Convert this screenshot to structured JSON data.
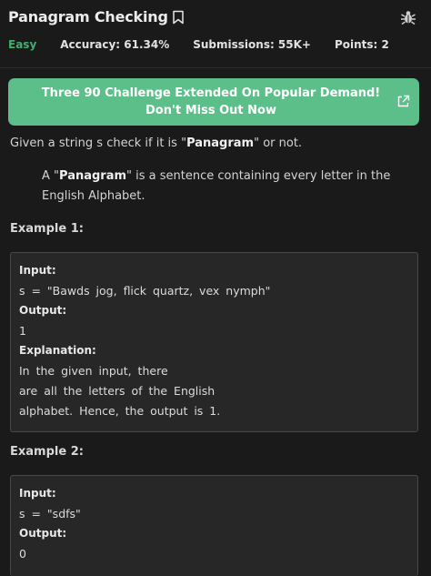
{
  "header": {
    "title": "Panagram Checking",
    "difficulty": "Easy",
    "accuracy": "Accuracy: 61.34%",
    "submissions": "Submissions: 55K+",
    "points": "Points: 2"
  },
  "banner": {
    "text": "Three 90 Challenge Extended On Popular Demand! Don't Miss Out Now"
  },
  "problem": {
    "intro_before": "Given a string s check if it is \"",
    "intro_bold": "Panagram",
    "intro_after": "\" or not.",
    "def_quote_open": "A \"",
    "def_bold": "Panagram",
    "def_line1_rest": "\" is a sentence containing every letter in the",
    "def_line2": "English Alphabet."
  },
  "example1": {
    "heading": "Example 1:",
    "input_label": "Input:",
    "input_value": "s = \"Bawds jog, flick quartz, vex nymph\"",
    "output_label": "Output:",
    "output_value": "1",
    "explanation_label": "Explanation:",
    "explanation_lines": [
      "In the given input, there",
      "are all the letters of the English",
      "alphabet. Hence, the output is 1."
    ]
  },
  "example2": {
    "heading": "Example 2:",
    "input_label": "Input:",
    "input_value": "s = \"sdfs\"",
    "output_label": "Output:",
    "output_value": "0"
  },
  "colors": {
    "background": "#1a1a1a",
    "banner": "#5cbf8a",
    "easy": "#3fae6e"
  },
  "icons": [
    "bookmark-icon",
    "bug-icon",
    "external-link-icon"
  ]
}
